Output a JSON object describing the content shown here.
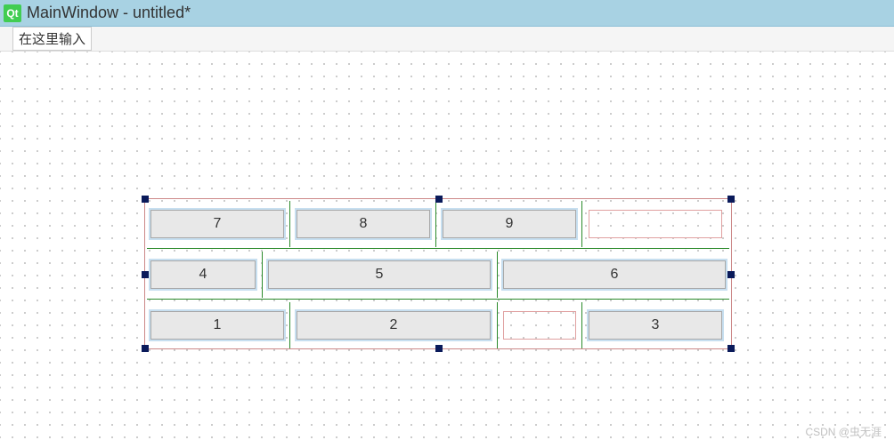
{
  "window": {
    "icon_label": "Qt",
    "title": "MainWindow - untitled*"
  },
  "menubar": {
    "placeholder_text": "在这里输入"
  },
  "layout": {
    "rows": [
      {
        "cells": [
          {
            "type": "button",
            "label": "7"
          },
          {
            "type": "button",
            "label": "8"
          },
          {
            "type": "button",
            "label": "9"
          },
          {
            "type": "placeholder",
            "label": ""
          }
        ]
      },
      {
        "cells": [
          {
            "type": "button",
            "label": "4"
          },
          {
            "type": "button",
            "label": "5"
          },
          {
            "type": "button",
            "label": "6"
          }
        ]
      },
      {
        "cells": [
          {
            "type": "button",
            "label": "1"
          },
          {
            "type": "button",
            "label": "2"
          },
          {
            "type": "placeholder",
            "label": ""
          },
          {
            "type": "button",
            "label": "3"
          }
        ]
      }
    ]
  },
  "watermark": "CSDN @虫无涯"
}
